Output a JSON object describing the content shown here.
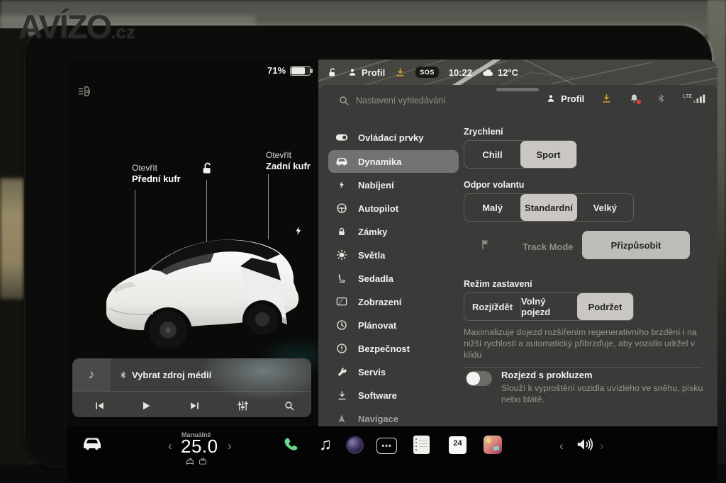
{
  "watermark": {
    "brand": "AVÍZO",
    "suffix": ".cz"
  },
  "car_status_bar": {
    "battery_percent": "71%",
    "profile_label": "Profil",
    "sos_label": "SOS",
    "time": "10:22",
    "temperature": "12°C"
  },
  "left_panel": {
    "front_trunk": {
      "action": "Otevřít",
      "label": "Přední kufr"
    },
    "rear_trunk": {
      "action": "Otevřít",
      "label": "Zadní kufr"
    },
    "media": {
      "source_label": "Vybrat zdroj médií"
    }
  },
  "settings": {
    "search_placeholder": "Nastavení vyhledávání",
    "profile_label": "Profil",
    "network_label": "LTE",
    "sidebar": {
      "items": [
        {
          "label": "Ovládací prvky",
          "icon": "toggle-icon",
          "selected": false
        },
        {
          "label": "Dynamika",
          "icon": "car-icon",
          "selected": true
        },
        {
          "label": "Nabíjení",
          "icon": "bolt-icon",
          "selected": false
        },
        {
          "label": "Autopilot",
          "icon": "steering-wheel-icon",
          "selected": false
        },
        {
          "label": "Zámky",
          "icon": "lock-icon",
          "selected": false
        },
        {
          "label": "Světla",
          "icon": "sun-icon",
          "selected": false
        },
        {
          "label": "Sedadla",
          "icon": "seat-icon",
          "selected": false
        },
        {
          "label": "Zobrazení",
          "icon": "display-icon",
          "selected": false
        },
        {
          "label": "Plánovat",
          "icon": "clock-icon",
          "selected": false
        },
        {
          "label": "Bezpečnost",
          "icon": "alert-icon",
          "selected": false
        },
        {
          "label": "Servis",
          "icon": "wrench-icon",
          "selected": false
        },
        {
          "label": "Software",
          "icon": "download-icon",
          "selected": false
        },
        {
          "label": "Navigace",
          "icon": "navigation-icon",
          "selected": false
        }
      ]
    },
    "acceleration": {
      "label": "Zrychlení",
      "options": [
        "Chill",
        "Sport"
      ],
      "selected": "Sport"
    },
    "steering": {
      "label": "Odpor volantu",
      "options": [
        "Malý",
        "Standardní",
        "Velký"
      ],
      "selected": "Standardní"
    },
    "track_mode": {
      "label": "Track Mode",
      "button_label": "Přizpůsobit"
    },
    "stopping_mode": {
      "label": "Režim zastavení",
      "options": [
        "Rozjíždět",
        "Volný pojezd",
        "Podržet"
      ],
      "selected": "Podržet",
      "description": "Maximalizuje dojezd rozšířením regenerativního brzdění i na nižší rychlosti a automatický přibrzďuje, aby vozidlo udržel v klidu"
    },
    "slip_start": {
      "label": "Rozjezd s prokluzem",
      "enabled": false,
      "description": "Slouží k vyproštění vozidla uvízlého ve sněhu, písku nebo blátě."
    }
  },
  "launcher": {
    "climate": {
      "mode": "Manuálně",
      "temperature": "25.0"
    },
    "calendar_day": "24"
  },
  "colors": {
    "panel": "#3a3b38",
    "selected_segment": "#cac7c3",
    "download_orange": "#dd9c2e",
    "phone_green": "#67d98e",
    "alert_red": "#e0453a"
  }
}
